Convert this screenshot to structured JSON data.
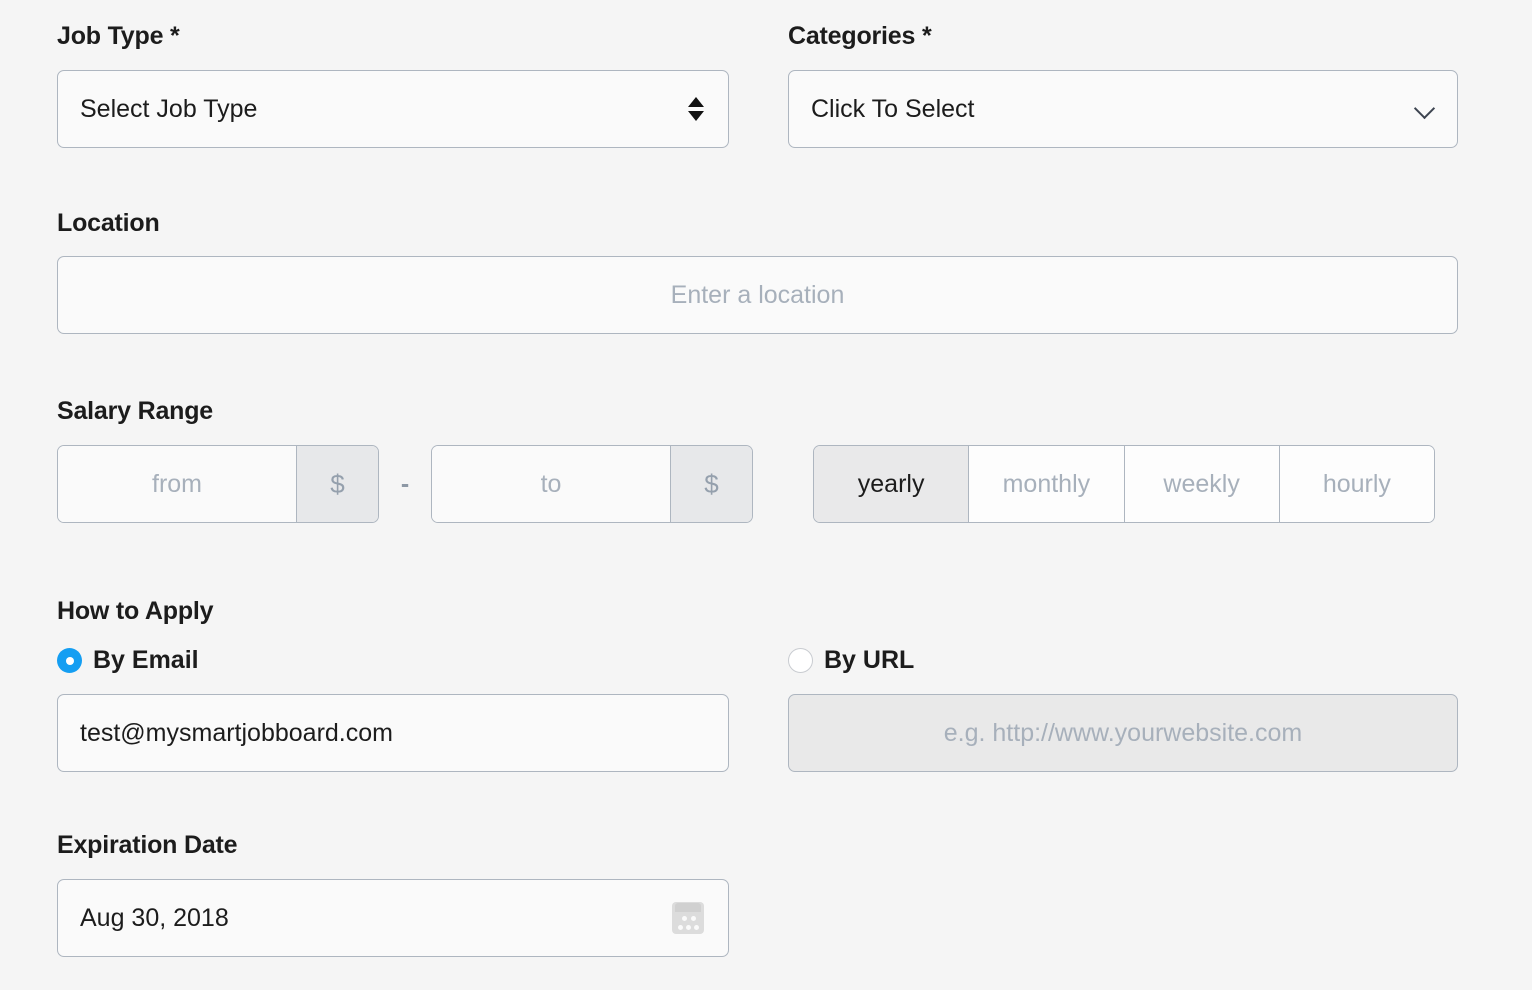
{
  "form": {
    "job_type": {
      "label": "Job Type *",
      "selected": "Select Job Type",
      "icon": "select-spinner-icon"
    },
    "categories": {
      "label": "Categories *",
      "selected": "Click To Select",
      "icon": "chevron-down-icon"
    },
    "location": {
      "label": "Location",
      "value": "",
      "placeholder": "Enter a location"
    },
    "salary": {
      "label": "Salary Range",
      "from_placeholder": "from",
      "to_placeholder": "to",
      "currency_symbol": "$",
      "separator": "-",
      "periods": [
        {
          "label": "yearly",
          "active": true
        },
        {
          "label": "monthly",
          "active": false
        },
        {
          "label": "weekly",
          "active": false
        },
        {
          "label": "hourly",
          "active": false
        }
      ]
    },
    "how_to_apply": {
      "label": "How to Apply",
      "email_option": {
        "label": "By Email",
        "checked": true,
        "value": "test@mysmartjobboard.com"
      },
      "url_option": {
        "label": "By URL",
        "checked": false,
        "value": "",
        "placeholder": "e.g. http://www.yourwebsite.com",
        "disabled": true
      }
    },
    "expiration": {
      "label": "Expiration Date",
      "value": "Aug 30, 2018",
      "icon": "calendar-icon"
    }
  },
  "colors": {
    "page_background": "#f5f5f5",
    "field_background": "#fafafa",
    "border": "#aeb6c0",
    "placeholder": "#a7b0bb",
    "text": "#1c1c1c",
    "accent_radio": "#149ef2",
    "addon_background": "#e7e8ea",
    "disabled_background": "#e9e9e9",
    "active_toggle_background": "#e9e9ea"
  }
}
